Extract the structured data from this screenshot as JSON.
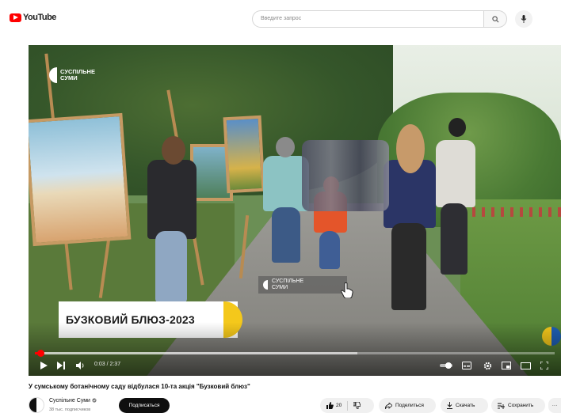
{
  "header": {
    "logo_text": "YouTube",
    "search_placeholder": "Введите запрос"
  },
  "video": {
    "watermark_line1": "СУСПІЛЬНЕ",
    "watermark_line2": "СУМИ",
    "overlay_line1": "СУСПІЛЬНЕ",
    "overlay_line2": "СУМИ",
    "banner_title": "БУЗКОВИЙ БЛЮЗ-2023",
    "time_current": "0:03",
    "time_total": "2:37",
    "time_separator": " / ",
    "progress_played_fraction": 0.012,
    "progress_buffered_fraction": 0.62
  },
  "meta": {
    "title": "У сумському ботанічному саду відбулася 10-та акція \"Бузковий блюз\"",
    "channel_name": "Суспільне Суми",
    "subscribers": "38 тыс. подписчиков",
    "subscribe_label": "Подписаться"
  },
  "actions": {
    "likes": "20",
    "share_label": "Поделиться",
    "download_label": "Скачать",
    "save_label": "Сохранить",
    "more_label": "···"
  },
  "colors": {
    "youtube_red": "#ff0000",
    "brand_yellow": "#f4c81b",
    "subscribe_bg": "#0f0f0f"
  }
}
